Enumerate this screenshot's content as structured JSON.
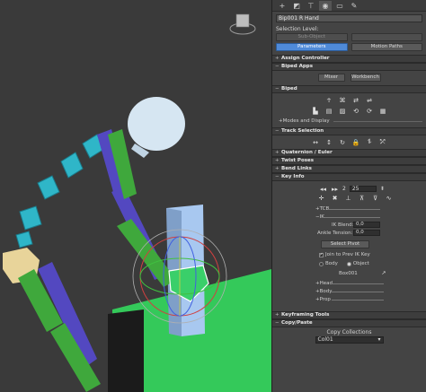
{
  "viewport": {
    "colors": {
      "ground": "#34c95a",
      "block_top": "#2fae4f",
      "block_front": "#1b1b1b",
      "post": "#a8c8f0",
      "head": "#d6e6f2",
      "spine": "#2fb6c8",
      "arm": "#3fa83c",
      "limb_blue": "#5348c0",
      "hand": "#3acf6a",
      "pelvis": "#e8d49a"
    },
    "gizmo_icon": "view-cube-icon"
  },
  "panel": {
    "tabs": [
      "create-icon",
      "modify-icon",
      "hierarchy-icon",
      "motion-icon",
      "display-icon",
      "utilities-icon"
    ],
    "object_name": "Bip001 R Hand",
    "selection_level_label": "Selection Level:",
    "sub_object_label": "Sub-Object",
    "parameters_label": "Parameters",
    "motion_paths_label": "Motion Paths",
    "rollouts": {
      "assign_controller": "Assign Controller",
      "biped_apps": "Biped Apps",
      "mixer": "Mixer",
      "workbench": "Workbench",
      "biped": "Biped",
      "modes_display": "Modes and Display",
      "track_selection": "Track Selection",
      "quaternion_euler": "Quaternion / Euler",
      "twist_poses": "Twist Poses",
      "bend_links": "Bend Links",
      "key_info": "Key Info",
      "keyframing_tools": "Keyframing Tools",
      "copy_paste": "Copy/Paste"
    },
    "key_info": {
      "key_number": "2",
      "frame_value": "25",
      "tcb_label": "TCB",
      "ik_label": "IK",
      "ik_blend_label": "IK Blend:",
      "ik_blend_value": "0,0",
      "ankle_tension_label": "Ankle Tension:",
      "ankle_tension_value": "0,0",
      "select_pivot": "Select Pivot",
      "join_label": "Join to Prev IK Key",
      "body_label": "Body",
      "object_label": "Object",
      "object_name": "Box001",
      "head_label": "Head",
      "body_sub_label": "Body",
      "prop_label": "Prop"
    },
    "copy_collections_label": "Copy Collections",
    "collection_value": "Col01"
  }
}
